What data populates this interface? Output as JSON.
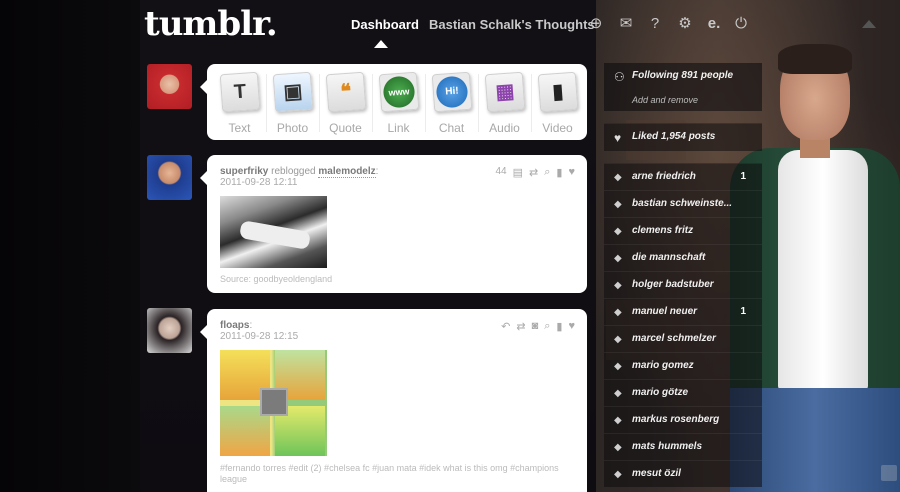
{
  "header": {
    "logo": "tumblr.",
    "nav_dashboard": "Dashboard",
    "nav_blog": "Bastian Schalk's Thoughts",
    "icons": [
      "plus-icon",
      "mail-icon",
      "help-icon",
      "gear-icon",
      "e-icon",
      "power-icon"
    ]
  },
  "composer": {
    "buttons": [
      {
        "label": "Text",
        "glyph": "T"
      },
      {
        "label": "Photo",
        "glyph": "▣"
      },
      {
        "label": "Quote",
        "glyph": "❝"
      },
      {
        "label": "Link",
        "glyph": "www"
      },
      {
        "label": "Chat",
        "glyph": "Hi!"
      },
      {
        "label": "Audio",
        "glyph": "▦"
      },
      {
        "label": "Video",
        "glyph": "▮"
      }
    ]
  },
  "posts": [
    {
      "user": "superfriky",
      "action": " reblogged ",
      "source_user": "malemodelz",
      "colon": ":",
      "date": "2011-09-28 12:11",
      "notes": "44",
      "source_label": "Source: goodbyeoldengland"
    },
    {
      "user": "floaps",
      "colon": ":",
      "date": "2011-09-28 12:15",
      "tags": "#fernando torres  #edit (2)  #chelsea fc  #juan mata  #idek what is this omg  #champions league"
    }
  ],
  "sidebar": {
    "following": "Following 891 people",
    "add_remove": "Add and remove",
    "liked": "Liked 1,954 posts",
    "tags": [
      {
        "label": "arne friedrich",
        "count": "1"
      },
      {
        "label": "bastian schweinste...",
        "count": ""
      },
      {
        "label": "clemens fritz",
        "count": ""
      },
      {
        "label": "die mannschaft",
        "count": ""
      },
      {
        "label": "holger badstuber",
        "count": ""
      },
      {
        "label": "manuel neuer",
        "count": "1"
      },
      {
        "label": "marcel schmelzer",
        "count": ""
      },
      {
        "label": "mario gomez",
        "count": ""
      },
      {
        "label": "mario götze",
        "count": ""
      },
      {
        "label": "markus rosenberg",
        "count": ""
      },
      {
        "label": "mats hummels",
        "count": ""
      },
      {
        "label": "mesut özil",
        "count": ""
      }
    ]
  }
}
